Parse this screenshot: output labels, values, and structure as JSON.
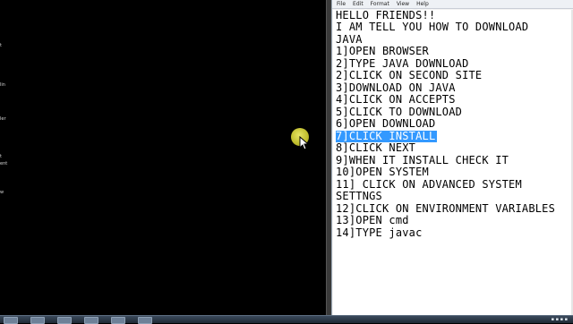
{
  "menu": [
    "File",
    "Edit",
    "Format",
    "View",
    "Help"
  ],
  "editor_lines": [
    "HELLO FRIENDS!!",
    "I AM TELL YOU HOW TO DOWNLOAD",
    "JAVA",
    "1]OPEN BROWSER",
    "2]TYPE JAVA DOWNLOAD",
    "2]CLICK ON SECOND SITE",
    "3]DOWNLOAD ON JAVA",
    "4]CLICK ON ACCEPTS",
    "5]CLICK TO DOWNLOAD",
    "6]OPEN DOWNLOAD",
    "7]CLICK INSTALL",
    "8]CLICK NEXT",
    "9]WHEN IT INSTALL CHECK IT",
    "10]OPEN SYSTEM",
    "11] CLICK ON ADVANCED SYSTEM",
    "SETTNGS",
    "12]CLICK ON ENVIRONMENT VARIABLES",
    "13]OPEN cmd",
    "14]TYPE javac"
  ],
  "selected_line_index": 10,
  "desktop_icon_labels": [
    "t",
    "lin",
    "ler",
    "t",
    "ent",
    "w"
  ],
  "colors": {
    "selection": "#3399ff",
    "cursor_highlight": "#d8d43a"
  }
}
